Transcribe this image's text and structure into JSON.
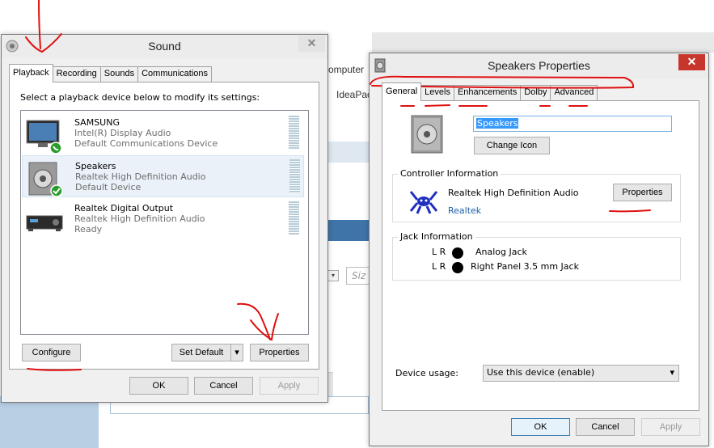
{
  "background": {
    "texts": [
      "omputer",
      "IdeaPac",
      "Siz"
    ]
  },
  "sound": {
    "title": "Sound",
    "tabs": [
      "Playback",
      "Recording",
      "Sounds",
      "Communications"
    ],
    "instruction": "Select a playback device below to modify its settings:",
    "devices": [
      {
        "name": "SAMSUNG",
        "line1": "Intel(R) Display Audio",
        "line2": "Default Communications Device"
      },
      {
        "name": "Speakers",
        "line1": "Realtek High Definition Audio",
        "line2": "Default Device"
      },
      {
        "name": "Realtek Digital Output",
        "line1": "Realtek High Definition Audio",
        "line2": "Ready"
      }
    ],
    "configure": "Configure",
    "set_default": "Set Default",
    "properties": "Properties",
    "ok": "OK",
    "cancel": "Cancel",
    "apply": "Apply"
  },
  "speakers": {
    "title": "Speakers Properties",
    "tabs": [
      "General",
      "Levels",
      "Enhancements",
      "Dolby",
      "Advanced"
    ],
    "name_value": "Speakers",
    "change_icon": "Change Icon",
    "controller": {
      "title": "Controller Information",
      "name": "Realtek High Definition Audio",
      "vendor": "Realtek",
      "properties": "Properties"
    },
    "jack": {
      "title": "Jack Information",
      "rows": [
        {
          "lr": "L R",
          "name": "Analog Jack"
        },
        {
          "lr": "L R",
          "name": "Right Panel 3.5 mm Jack"
        }
      ]
    },
    "device_usage_label": "Device usage:",
    "device_usage_value": "Use this device (enable)",
    "ok": "OK",
    "cancel": "Cancel",
    "apply": "Apply"
  },
  "colors": {
    "annotation": "#e01010",
    "close_red": "#c7352d",
    "selection": "#3399ff"
  }
}
